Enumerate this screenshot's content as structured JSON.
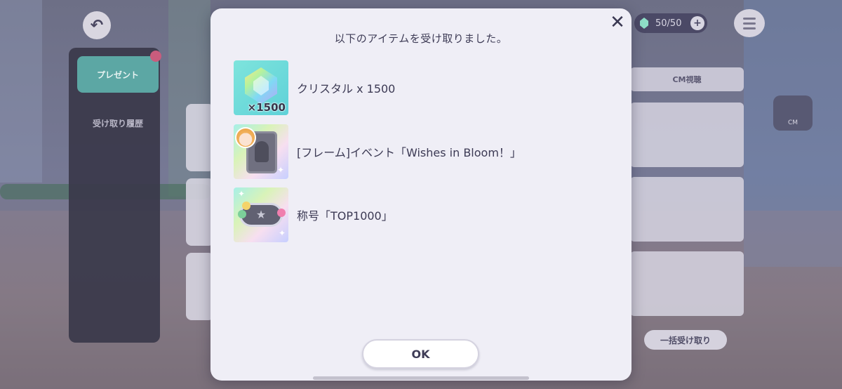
{
  "background": {
    "crystal_counter": "50/50",
    "side_tabs": [
      {
        "label": "プレゼント"
      },
      {
        "label": "受け取り履歴"
      }
    ],
    "cm_label": "CM視聴",
    "cm_icon_label": "CM",
    "receive_all_label": "一括受け取り"
  },
  "dialog": {
    "title": "以下のアイテムを受け取りました。",
    "items": [
      {
        "icon": "crystal-icon",
        "quantity": "×1500",
        "label": "クリスタル x 1500"
      },
      {
        "icon": "frame-icon",
        "label": "[フレーム]イベント「Wishes in Bloom！」"
      },
      {
        "icon": "title-plate-icon",
        "label": "称号「TOP1000」"
      }
    ],
    "ok_label": "OK",
    "close_icon": "close-icon"
  },
  "colors": {
    "dialog_bg": "#efeef6",
    "accent_teal": "#5ca7a4",
    "text_dark": "#3e3c56"
  }
}
